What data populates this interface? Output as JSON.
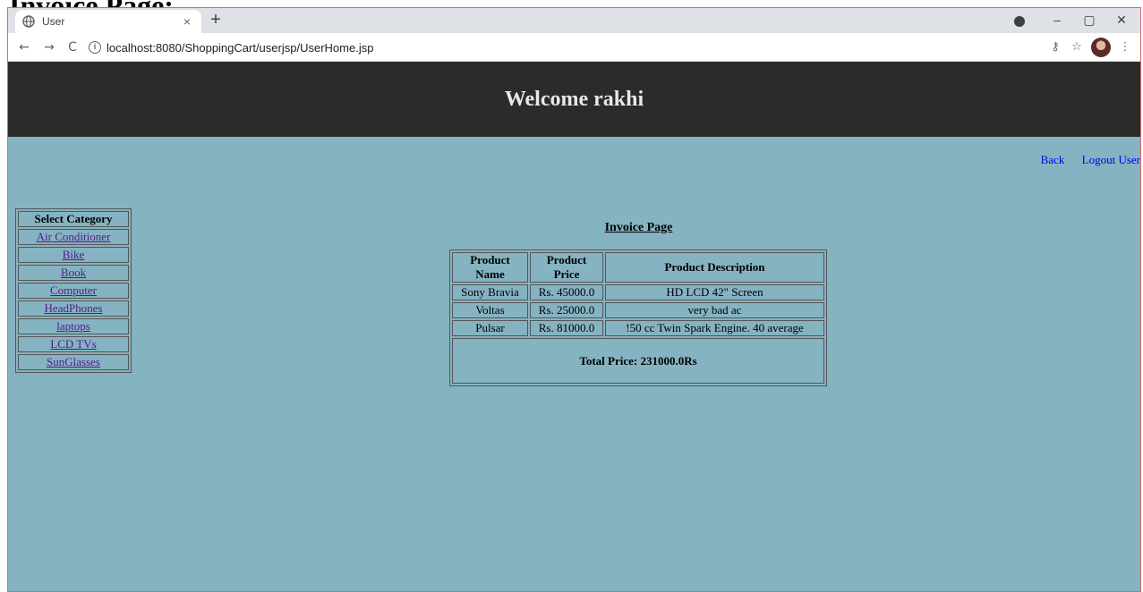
{
  "doc_heading": "Invoice Page:",
  "browser": {
    "tab_title": "User",
    "tab_close": "×",
    "new_tab": "+",
    "url": "localhost:8080/ShoppingCart/userjsp/UserHome.jsp",
    "controls": {
      "minimize": "–",
      "maximize": "▢",
      "close": "✕"
    },
    "nav": {
      "back": "←",
      "forward": "→",
      "reload": "C"
    },
    "toolbar_icons": {
      "key": "⚷",
      "star": "☆",
      "menu": "⋮"
    }
  },
  "page": {
    "banner_title": "Welcome rakhi",
    "links": {
      "back": "Back",
      "logout": "Logout User"
    },
    "categories": {
      "header": "Select Category",
      "items": [
        "Air Conditioner",
        "Bike",
        "Book",
        "Computer",
        "HeadPhones",
        "laptops",
        "LCD TVs",
        "SunGlasses"
      ]
    },
    "invoice": {
      "title": "Invoice Page",
      "headers": [
        "Product Name",
        "Product Price",
        "Product Description"
      ],
      "rows": [
        [
          "Sony Bravia",
          "Rs. 45000.0",
          "HD LCD 42\" Screen"
        ],
        [
          "Voltas",
          "Rs. 25000.0",
          "very bad ac"
        ],
        [
          "Pulsar",
          "Rs. 81000.0",
          "!50 cc Twin Spark Engine. 40 average"
        ]
      ],
      "total": "Total Price: 231000.0Rs"
    }
  }
}
